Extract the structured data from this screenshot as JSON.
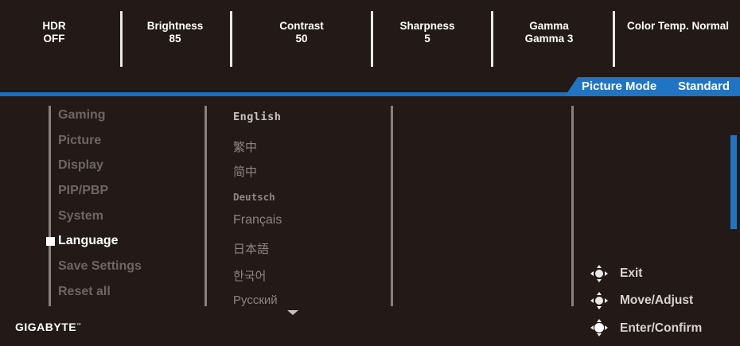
{
  "status": {
    "hdr": {
      "label": "HDR",
      "value": "OFF"
    },
    "brightness": {
      "label": "Brightness",
      "value": "85"
    },
    "contrast": {
      "label": "Contrast",
      "value": "50"
    },
    "sharpness": {
      "label": "Sharpness",
      "value": "5"
    },
    "gamma": {
      "label": "Gamma",
      "value": "Gamma 3"
    },
    "color_temp": {
      "label": "Color Temp.",
      "value": "Normal"
    }
  },
  "picture_mode": {
    "label": "Picture Mode",
    "value": "Standard"
  },
  "menu": {
    "items": [
      "Gaming",
      "Picture",
      "Display",
      "PIP/PBP",
      "System",
      "Language",
      "Save Settings",
      "Reset all"
    ],
    "selected": "Language"
  },
  "languages": [
    "English",
    "繁中",
    "简中",
    "Deutsch",
    "Français",
    "日本語",
    "한국어",
    "Русский"
  ],
  "current_language": "English",
  "hints": {
    "exit": "Exit",
    "move": "Move/Adjust",
    "enter": "Enter/Confirm"
  },
  "brand": "GIGABYTE",
  "colors": {
    "accent": "#1f74c4",
    "background": "#231a17",
    "dim_text": "#6e6661"
  }
}
